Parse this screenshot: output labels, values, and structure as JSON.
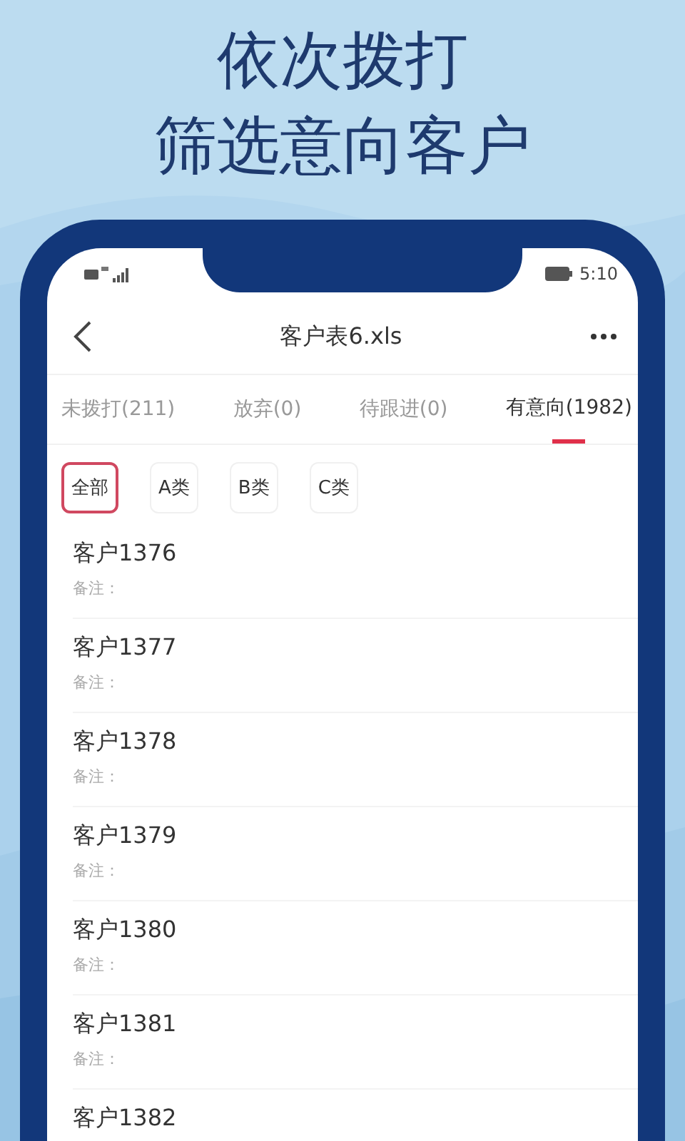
{
  "headline": [
    "依次拨打",
    "筛选意向客户"
  ],
  "status_bar": {
    "time": "5:10"
  },
  "nav": {
    "title": "客户表6.xls"
  },
  "tabs": [
    {
      "label": "未拨打(211)",
      "selected": false
    },
    {
      "label": "放弃(0)",
      "selected": false
    },
    {
      "label": "待跟进(0)",
      "selected": false
    },
    {
      "label": "有意向(1982)",
      "selected": true
    }
  ],
  "filters": [
    {
      "label": "全部",
      "selected": true
    },
    {
      "label": "A类",
      "selected": false
    },
    {
      "label": "B类",
      "selected": false
    },
    {
      "label": "C类",
      "selected": false
    }
  ],
  "customers": [
    {
      "name": "客户1376",
      "note": "备注："
    },
    {
      "name": "客户1377",
      "note": "备注："
    },
    {
      "name": "客户1378",
      "note": "备注："
    },
    {
      "name": "客户1379",
      "note": "备注："
    },
    {
      "name": "客户1380",
      "note": "备注："
    },
    {
      "name": "客户1381",
      "note": "备注："
    },
    {
      "name": "客户1382"
    }
  ]
}
